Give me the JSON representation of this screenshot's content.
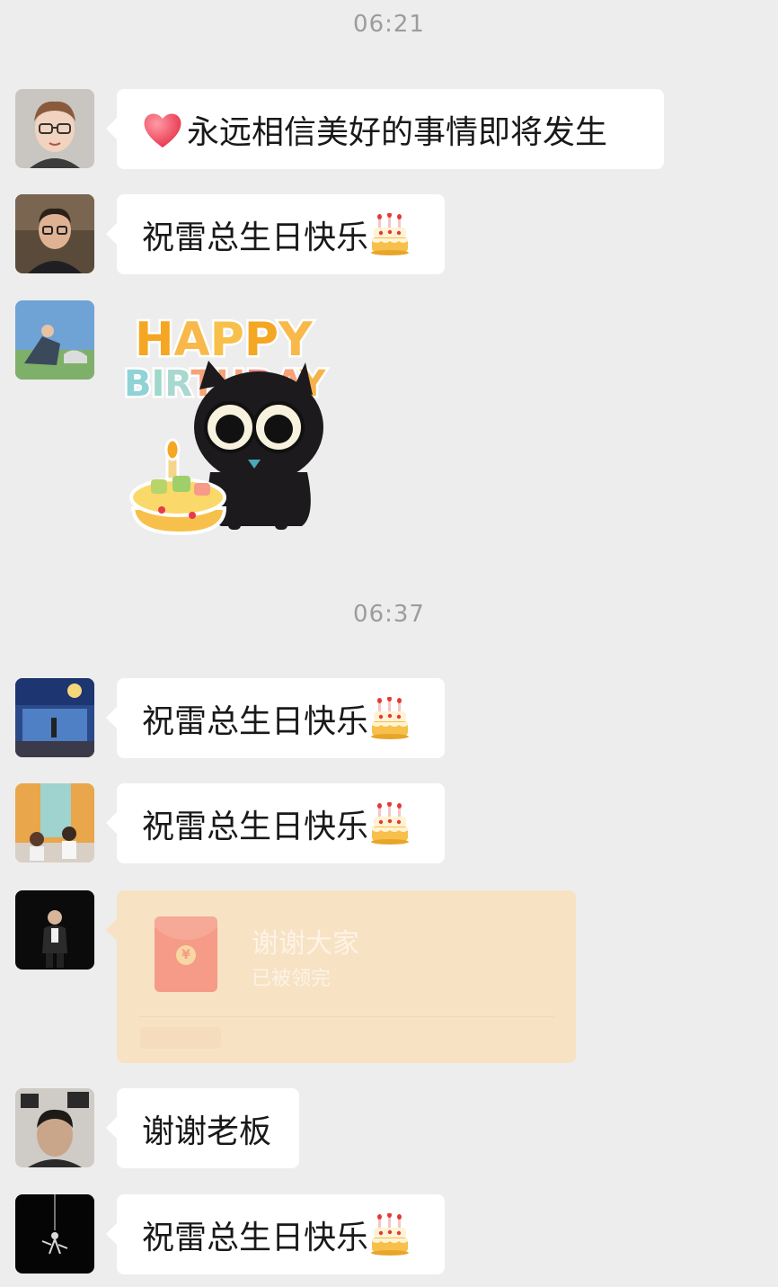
{
  "timestamps": [
    "06:21",
    "06:37"
  ],
  "messages": [
    {
      "text": "永远相信美好的事情即将发生",
      "leading_emoji": "heart-icon"
    },
    {
      "text": "祝雷总生日快乐",
      "trailing_emoji": "birthday-cake-icon"
    },
    {
      "sticker_line1": "HAPPY",
      "sticker_line2": "BIRTHDAY"
    },
    {
      "text": "祝雷总生日快乐",
      "trailing_emoji": "birthday-cake-icon"
    },
    {
      "text": "祝雷总生日快乐",
      "trailing_emoji": "birthday-cake-icon"
    },
    {
      "red_packet": {
        "title": "谢谢大家",
        "status": "已被领完",
        "symbol": "¥"
      }
    },
    {
      "text": "谢谢老板"
    },
    {
      "text": "祝雷总生日快乐",
      "trailing_emoji": "birthday-cake-icon"
    }
  ],
  "colors": {
    "background": "#ededed",
    "bubble": "#ffffff",
    "red_packet_bg": "#f7e2c4",
    "red_packet_envelope": "#f59b87",
    "timestamp_text": "#9c9c9c"
  }
}
